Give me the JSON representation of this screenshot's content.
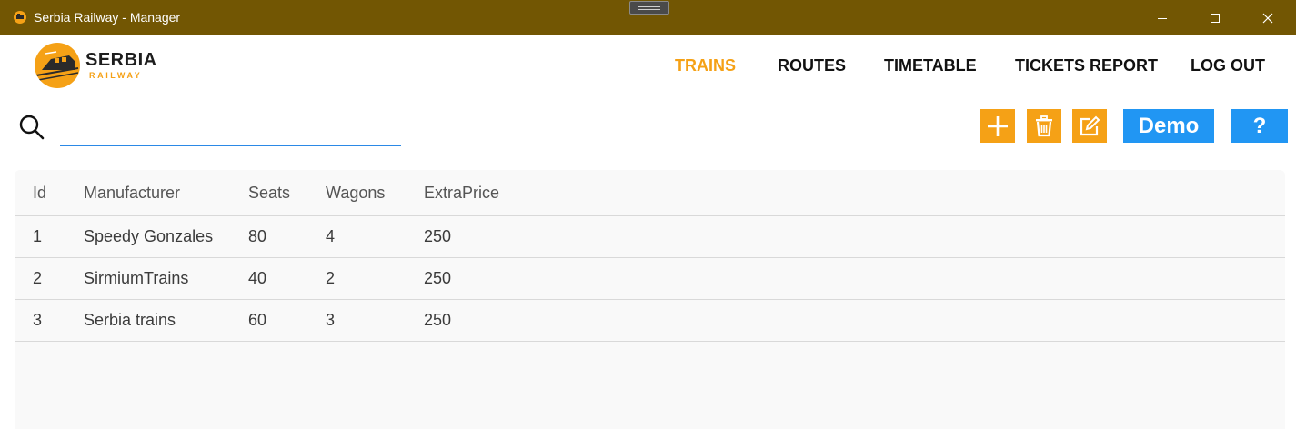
{
  "window": {
    "title": "Serbia Railway - Manager"
  },
  "logo": {
    "name": "SERBIA",
    "sub": "RAILWAY"
  },
  "nav": {
    "items": [
      {
        "label": "TRAINS",
        "active": true
      },
      {
        "label": "ROUTES",
        "active": false
      },
      {
        "label": "TIMETABLE",
        "active": false
      },
      {
        "label": "TICKETS REPORT",
        "active": false
      },
      {
        "label": "LOG OUT",
        "active": false
      }
    ]
  },
  "search": {
    "value": "",
    "placeholder": ""
  },
  "toolbar": {
    "add_icon": "plus-icon",
    "delete_icon": "trash-icon",
    "edit_icon": "edit-icon",
    "demo_label": "Demo",
    "help_label": "?"
  },
  "table": {
    "columns": [
      "Id",
      "Manufacturer",
      "Seats",
      "Wagons",
      "ExtraPrice"
    ],
    "rows": [
      [
        "1",
        "Speedy Gonzales",
        "80",
        "4",
        "250"
      ],
      [
        "2",
        "SirmiumTrains",
        "40",
        "2",
        "250"
      ],
      [
        "3",
        "Serbia trains",
        "60",
        "3",
        "250"
      ]
    ]
  },
  "colors": {
    "titlebar": "#725603",
    "accent_orange": "#f5a116",
    "accent_blue": "#2196f3",
    "search_underline": "#2b89e6"
  }
}
